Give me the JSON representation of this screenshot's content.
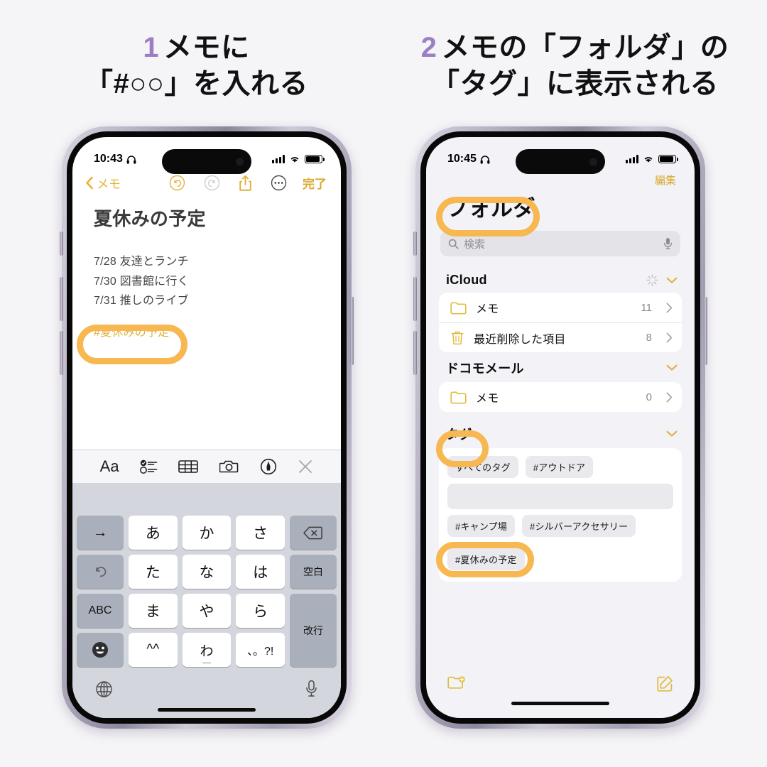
{
  "headings": [
    {
      "number": "1",
      "lines": [
        "メモに",
        "「#○○」を入れる"
      ]
    },
    {
      "number": "2",
      "lines": [
        "メモの「フォルダ」の",
        "「タグ」に表示される"
      ]
    }
  ],
  "accent_colors": {
    "number_purple": "#9b7fc4",
    "highlight_orange": "#f7b852",
    "notes_yellow": "#d9a92b",
    "page_background": "#f5f4f7"
  },
  "phone1": {
    "status": {
      "time": "10:43",
      "headphones_icon": "headphone-icon",
      "signal_icon": "cellular-bars-icon",
      "wifi_icon": "wifi-icon",
      "battery_icon": "battery-icon"
    },
    "nav": {
      "back_label": "メモ",
      "back_icon": "chevron-left-icon",
      "undo_icon": "undo-icon",
      "redo_icon": "redo-icon",
      "share_icon": "share-icon",
      "more_icon": "more-circle-icon",
      "done_label": "完了"
    },
    "note": {
      "title": "夏休みの予定",
      "lines": [
        "7/28 友達とランチ",
        "7/30 図書館に行く",
        "7/31 推しのライブ"
      ],
      "hashtag": "#夏休みの予定"
    },
    "toolbar": [
      {
        "name": "format-aa-icon",
        "label": "Aa"
      },
      {
        "name": "checklist-icon",
        "label": ""
      },
      {
        "name": "table-icon",
        "label": ""
      },
      {
        "name": "camera-icon",
        "label": ""
      },
      {
        "name": "markup-pen-icon",
        "label": ""
      },
      {
        "name": "close-icon",
        "label": ""
      }
    ],
    "keyboard": {
      "rows": [
        [
          "→",
          "あ",
          "か",
          "さ",
          "delete-icon"
        ],
        [
          "undo-icon",
          "た",
          "な",
          "は",
          "空白"
        ],
        [
          "ABC",
          "ま",
          "や",
          "ら",
          "改行"
        ],
        [
          "emoji-icon",
          "^^",
          "わ",
          "、。?!",
          ""
        ]
      ],
      "globe_icon": "globe-icon",
      "mic_icon": "microphone-icon"
    }
  },
  "phone2": {
    "status": {
      "time": "10:45",
      "headphones_icon": "headphone-icon",
      "signal_icon": "cellular-bars-icon",
      "wifi_icon": "wifi-icon",
      "battery_icon": "battery-icon"
    },
    "edit_label": "編集",
    "title": "フォルダ",
    "search": {
      "placeholder": "検索",
      "search_icon": "search-icon",
      "mic_icon": "microphone-icon"
    },
    "sections": [
      {
        "title": "iCloud",
        "has_sync_spinner": true,
        "rows": [
          {
            "icon": "folder-icon",
            "label": "メモ",
            "count": "11"
          },
          {
            "icon": "trash-icon",
            "label": "最近削除した項目",
            "count": "8"
          }
        ]
      },
      {
        "title": "ドコモメール",
        "has_sync_spinner": false,
        "rows": [
          {
            "icon": "folder-icon",
            "label": "メモ",
            "count": "0"
          }
        ]
      }
    ],
    "tags_section": {
      "title": "タグ",
      "chips": [
        "すべてのタグ",
        "#アウトドア",
        "",
        "#キャンプ場",
        "#シルバーアクセサリー",
        "#夏休みの予定"
      ]
    },
    "bottom": {
      "new_folder_icon": "new-folder-icon",
      "compose_icon": "compose-icon"
    }
  }
}
